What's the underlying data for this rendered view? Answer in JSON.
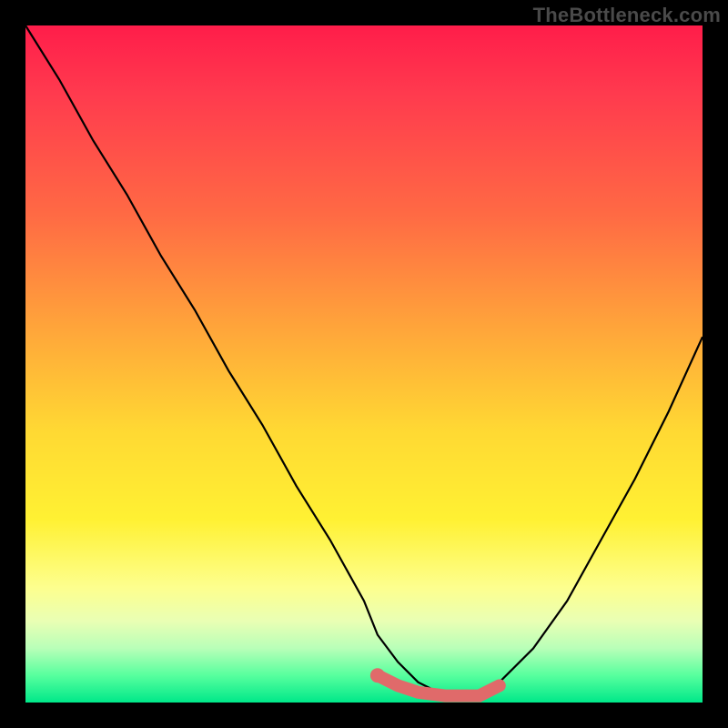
{
  "watermark": "TheBottleneck.com",
  "chart_data": {
    "type": "line",
    "title": "",
    "xlabel": "",
    "ylabel": "",
    "xlim": [
      0,
      100
    ],
    "ylim": [
      0,
      100
    ],
    "series": [
      {
        "name": "bottleneck-curve",
        "x": [
          0,
          5,
          10,
          15,
          20,
          25,
          30,
          35,
          40,
          45,
          50,
          52,
          55,
          58,
          62,
          67,
          70,
          75,
          80,
          85,
          90,
          95,
          100
        ],
        "y": [
          100,
          92,
          83,
          75,
          66,
          58,
          49,
          41,
          32,
          24,
          15,
          10,
          6,
          3,
          1,
          1,
          3,
          8,
          15,
          24,
          33,
          43,
          54
        ]
      }
    ],
    "annotations": [
      {
        "name": "highlight-segment",
        "type": "thick-line",
        "color": "#e06a6a",
        "x": [
          52,
          55,
          58,
          62,
          67,
          70
        ],
        "y": [
          4,
          2.5,
          1.5,
          1,
          1,
          2.5
        ]
      },
      {
        "name": "highlight-dot",
        "type": "point",
        "color": "#e06a6a",
        "x": 52,
        "y": 4
      }
    ],
    "gradient_stops": [
      {
        "pos": 0,
        "color": "#ff1d4a"
      },
      {
        "pos": 28,
        "color": "#ff6a44"
      },
      {
        "pos": 60,
        "color": "#ffd933"
      },
      {
        "pos": 83,
        "color": "#fdff8e"
      },
      {
        "pos": 100,
        "color": "#00e889"
      }
    ]
  }
}
